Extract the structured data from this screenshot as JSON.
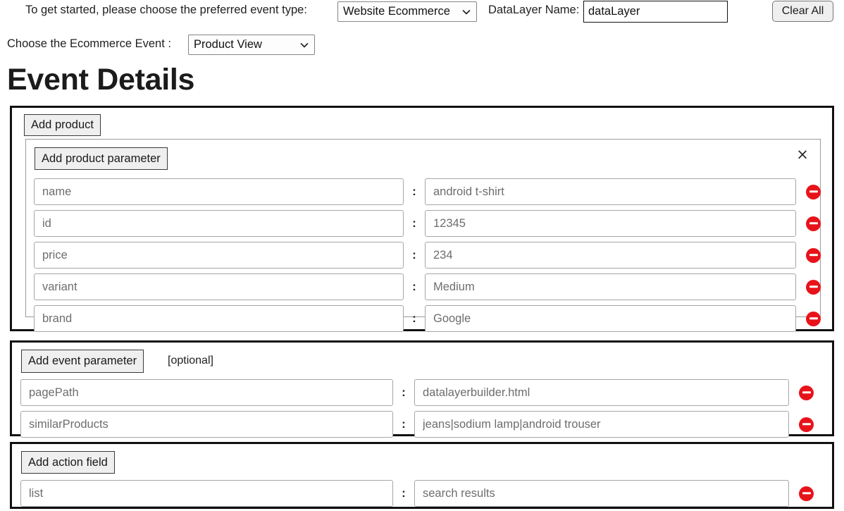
{
  "header": {
    "event_type_label": "To get started, please choose the preferred event type:",
    "event_type_selected": "Website Ecommerce",
    "event_type_options": [
      "Website Ecommerce"
    ],
    "datalayer_name_label": "DataLayer Name:",
    "datalayer_name_value": "dataLayer",
    "datalayer_name_placeholder": "dataLayer",
    "clear_all_label": "Clear All",
    "ecommerce_event_label": "Choose the Ecommerce Event  :",
    "ecommerce_event_selected": "Product View",
    "ecommerce_event_options": [
      "Product View"
    ]
  },
  "page_title": "Event Details",
  "product_section": {
    "add_product_label": "Add product",
    "add_product_parameter_label": "Add product parameter",
    "close_icon_label": "×",
    "rows": [
      {
        "key": "name",
        "value": "android t-shirt"
      },
      {
        "key": "id",
        "value": "12345"
      },
      {
        "key": "price",
        "value": "234"
      },
      {
        "key": "variant",
        "value": "Medium"
      },
      {
        "key": "brand",
        "value": "Google"
      }
    ]
  },
  "event_parameter_section": {
    "add_event_parameter_label": "Add event parameter",
    "optional_note": "[optional]",
    "rows": [
      {
        "key": "pagePath",
        "value": "datalayerbuilder.html"
      },
      {
        "key": "similarProducts",
        "value": "jeans|sodium lamp|android trouser"
      }
    ]
  },
  "action_field_section": {
    "add_action_field_label": "Add action field",
    "rows": [
      {
        "key": "list",
        "value": "search results"
      }
    ]
  },
  "colors": {
    "remove_icon": "#e8131a",
    "section_border": "#111111",
    "button_face": "#efefef",
    "input_border": "#a6a6a6"
  },
  "icons": {
    "remove": "remove-circle-icon",
    "close": "close-icon",
    "dropdown": "chevron-down-icon"
  }
}
